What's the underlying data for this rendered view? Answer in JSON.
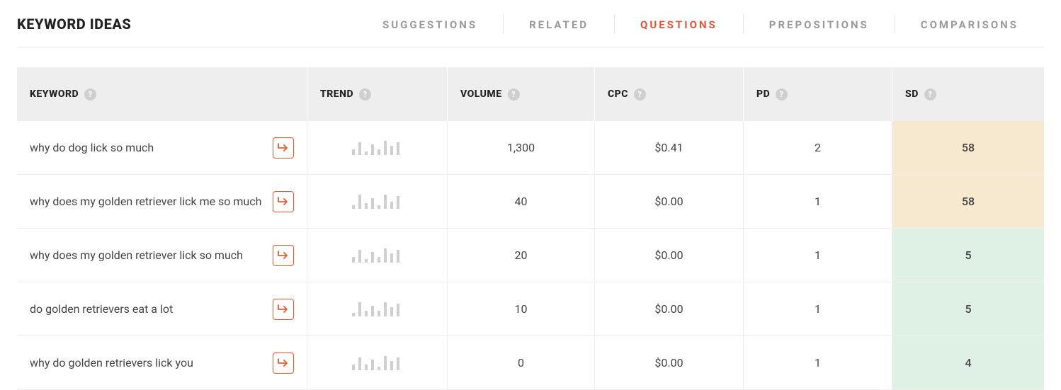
{
  "title": "KEYWORD IDEAS",
  "tabs": [
    {
      "label": "SUGGESTIONS",
      "active": false
    },
    {
      "label": "RELATED",
      "active": false
    },
    {
      "label": "QUESTIONS",
      "active": true
    },
    {
      "label": "PREPOSITIONS",
      "active": false
    },
    {
      "label": "COMPARISONS",
      "active": false
    }
  ],
  "columns": {
    "keyword": "KEYWORD",
    "trend": "TREND",
    "volume": "VOLUME",
    "cpc": "CPC",
    "pd": "PD",
    "sd": "SD"
  },
  "help_glyph": "?",
  "rows": [
    {
      "keyword": "why do dog lick so much",
      "volume": "1,300",
      "cpc": "$0.41",
      "pd": "2",
      "sd": "58",
      "sd_class": "sd-warm",
      "spark": [
        3,
        7,
        2,
        6,
        3,
        8,
        5,
        7
      ]
    },
    {
      "keyword": "why does my golden retriever lick me so much",
      "volume": "40",
      "cpc": "$0.00",
      "pd": "1",
      "sd": "58",
      "sd_class": "sd-warm",
      "spark": [
        2,
        8,
        3,
        6,
        2,
        8,
        4,
        7
      ]
    },
    {
      "keyword": "why does my golden retriever lick so much",
      "volume": "20",
      "cpc": "$0.00",
      "pd": "1",
      "sd": "5",
      "sd_class": "sd-good",
      "spark": [
        3,
        7,
        2,
        6,
        3,
        8,
        5,
        7
      ]
    },
    {
      "keyword": "do golden retrievers eat a lot",
      "volume": "10",
      "cpc": "$0.00",
      "pd": "1",
      "sd": "5",
      "sd_class": "sd-good",
      "spark": [
        2,
        8,
        3,
        6,
        3,
        8,
        5,
        7
      ]
    },
    {
      "keyword": "why do golden retrievers lick you",
      "volume": "0",
      "cpc": "$0.00",
      "pd": "1",
      "sd": "4",
      "sd_class": "sd-good",
      "spark": [
        3,
        7,
        3,
        6,
        2,
        8,
        5,
        7
      ]
    }
  ],
  "colors": {
    "accent": "#e2573a",
    "sd_warm": "#f7e9cf",
    "sd_good": "#dff0e4"
  }
}
